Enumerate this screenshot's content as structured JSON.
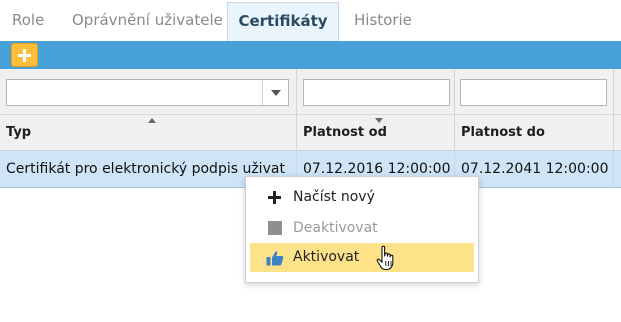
{
  "tabs": [
    {
      "label": "Role"
    },
    {
      "label": "Oprávnění uživatele"
    },
    {
      "label": "Certifikáty",
      "active": true
    },
    {
      "label": "Historie"
    }
  ],
  "colors": {
    "toolbar": "#47a1d7",
    "add_button": "#ffbd3c",
    "selected_row": "#cfe4f7",
    "menu_hover": "#fde28a",
    "active_tab_bg": "#eaf4fc"
  },
  "toolbar": {
    "add_icon": "plus-icon"
  },
  "grid": {
    "columns": [
      {
        "label": "Typ",
        "sort": "up"
      },
      {
        "label": "Platnost od",
        "sort": "down"
      },
      {
        "label": "Platnost do"
      }
    ],
    "rows": [
      {
        "typ": "Certifikát pro elektronický podpis uživat",
        "od": "07.12.2016 12:00:00",
        "do": "07.12.2041 12:00:00"
      }
    ]
  },
  "context_menu": {
    "items": [
      {
        "label": "Načíst nový",
        "icon": "plus-icon",
        "enabled": true
      },
      {
        "label": "Deaktivovat",
        "icon": "square-icon",
        "enabled": false
      },
      {
        "label": "Aktivovat",
        "icon": "thumbs-up-icon",
        "enabled": true,
        "hovered": true
      }
    ]
  }
}
